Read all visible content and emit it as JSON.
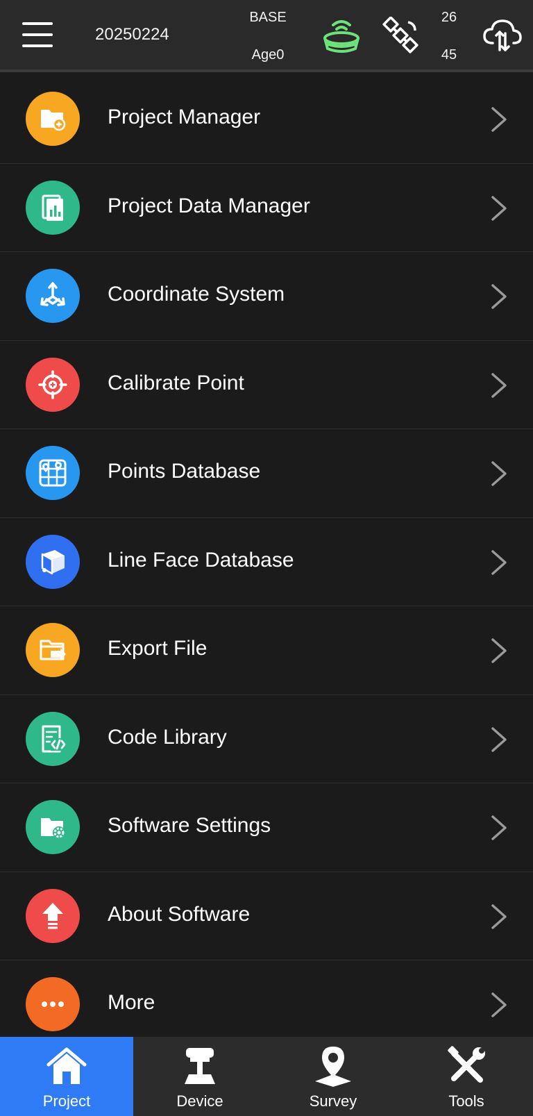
{
  "header": {
    "project_name": "20250224",
    "base_label": "BASE",
    "age_label": "Age0",
    "sat_count_top": "26",
    "sat_count_bottom": "45",
    "receiver_status_color": "#6ee27a"
  },
  "menu": {
    "items": [
      {
        "label": "Project Manager",
        "icon": "folder-add-icon",
        "color": "#f8a723"
      },
      {
        "label": "Project Data Manager",
        "icon": "data-chart-icon",
        "color": "#2fb98a"
      },
      {
        "label": "Coordinate System",
        "icon": "axes-icon",
        "color": "#2797f0"
      },
      {
        "label": "Calibrate Point",
        "icon": "crosshair-icon",
        "color": "#ef4b4b"
      },
      {
        "label": "Points Database",
        "icon": "map-grid-icon",
        "color": "#2797f0"
      },
      {
        "label": "Line Face Database",
        "icon": "cube-icon",
        "color": "#2f6ff0"
      },
      {
        "label": "Export File",
        "icon": "folder-export-icon",
        "color": "#f8a723"
      },
      {
        "label": "Code Library",
        "icon": "code-doc-icon",
        "color": "#2fb98a"
      },
      {
        "label": "Software Settings",
        "icon": "folder-gear-icon",
        "color": "#2fb98a"
      },
      {
        "label": "About Software",
        "icon": "upgrade-arrow-icon",
        "color": "#ef4b4b"
      },
      {
        "label": "More",
        "icon": "more-dots-icon",
        "color": "#f26a24"
      }
    ]
  },
  "tabs": [
    {
      "label": "Project",
      "icon": "home-icon",
      "active": true
    },
    {
      "label": "Device",
      "icon": "gnss-receiver-icon",
      "active": false
    },
    {
      "label": "Survey",
      "icon": "location-pin-icon",
      "active": false
    },
    {
      "label": "Tools",
      "icon": "tools-icon",
      "active": false
    }
  ],
  "colors": {
    "background": "#1b1b1b",
    "header_bg": "#2a2a2a",
    "tab_active": "#2f7bf6",
    "tab_bg": "#2c2c2c"
  }
}
